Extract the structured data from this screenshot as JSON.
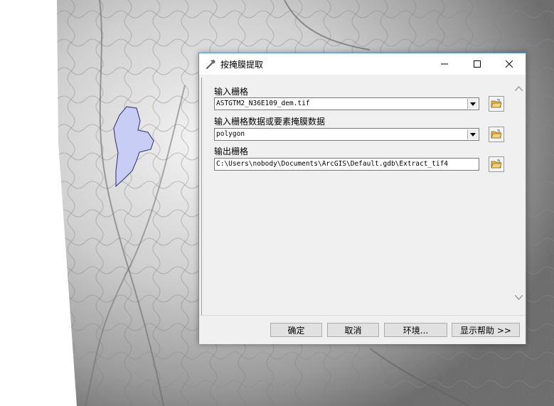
{
  "dialog": {
    "title": "按掩膜提取",
    "icon": "hammer-icon"
  },
  "window_controls": {
    "minimize_icon": "minimize-icon",
    "maximize_icon": "maximize-icon",
    "close_icon": "close-icon"
  },
  "fields": {
    "input_raster": {
      "label": "输入栅格",
      "value": "ASTGTM2_N36E109_dem.tif"
    },
    "mask_data": {
      "label": "输入栅格数据或要素掩膜数据",
      "value": "polygon"
    },
    "output_raster": {
      "label": "输出栅格",
      "value": "C:\\Users\\nobody\\Documents\\ArcGIS\\Default.gdb\\Extract_tif4"
    }
  },
  "buttons": {
    "ok": "确定",
    "cancel": "取消",
    "environments": "环境...",
    "show_help": "显示帮助 >>"
  },
  "colors": {
    "dialog_border": "#4a90d9",
    "polygon_fill": "#c8cdf5",
    "folder_icon": "#e8b84a"
  }
}
